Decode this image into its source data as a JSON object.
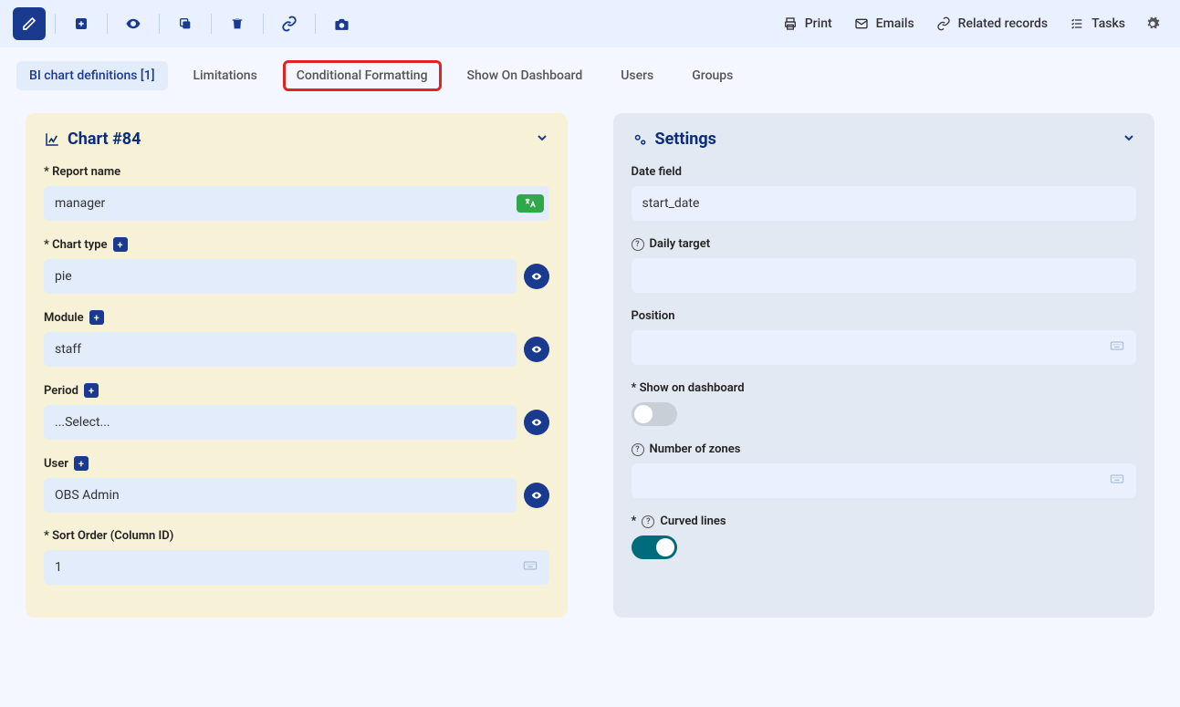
{
  "toolbar": {
    "print": "Print",
    "emails": "Emails",
    "related": "Related records",
    "tasks": "Tasks"
  },
  "tabs": {
    "bi_chart_defs": "BI chart definitions [1]",
    "limitations": "Limitations",
    "conditional_formatting": "Conditional Formatting",
    "show_on_dashboard": "Show On Dashboard",
    "users": "Users",
    "groups": "Groups"
  },
  "chart_panel": {
    "title": "Chart #84",
    "report_name_label": "* Report name",
    "report_name_value": "manager",
    "chart_type_label": "* Chart type",
    "chart_type_value": "pie",
    "module_label": "Module",
    "module_value": "staff",
    "period_label": "Period",
    "period_value": "...Select...",
    "user_label": "User",
    "user_value": "OBS Admin",
    "sort_order_label": "* Sort Order (Column ID)",
    "sort_order_value": "1"
  },
  "settings_panel": {
    "title": "Settings",
    "date_field_label": "Date field",
    "date_field_value": "start_date",
    "daily_target_label": "Daily target",
    "position_label": "Position",
    "show_on_dashboard_label": "* Show on dashboard",
    "zones_label": "Number of zones",
    "curved_lines_label": "Curved lines",
    "curved_prefix": "*"
  }
}
